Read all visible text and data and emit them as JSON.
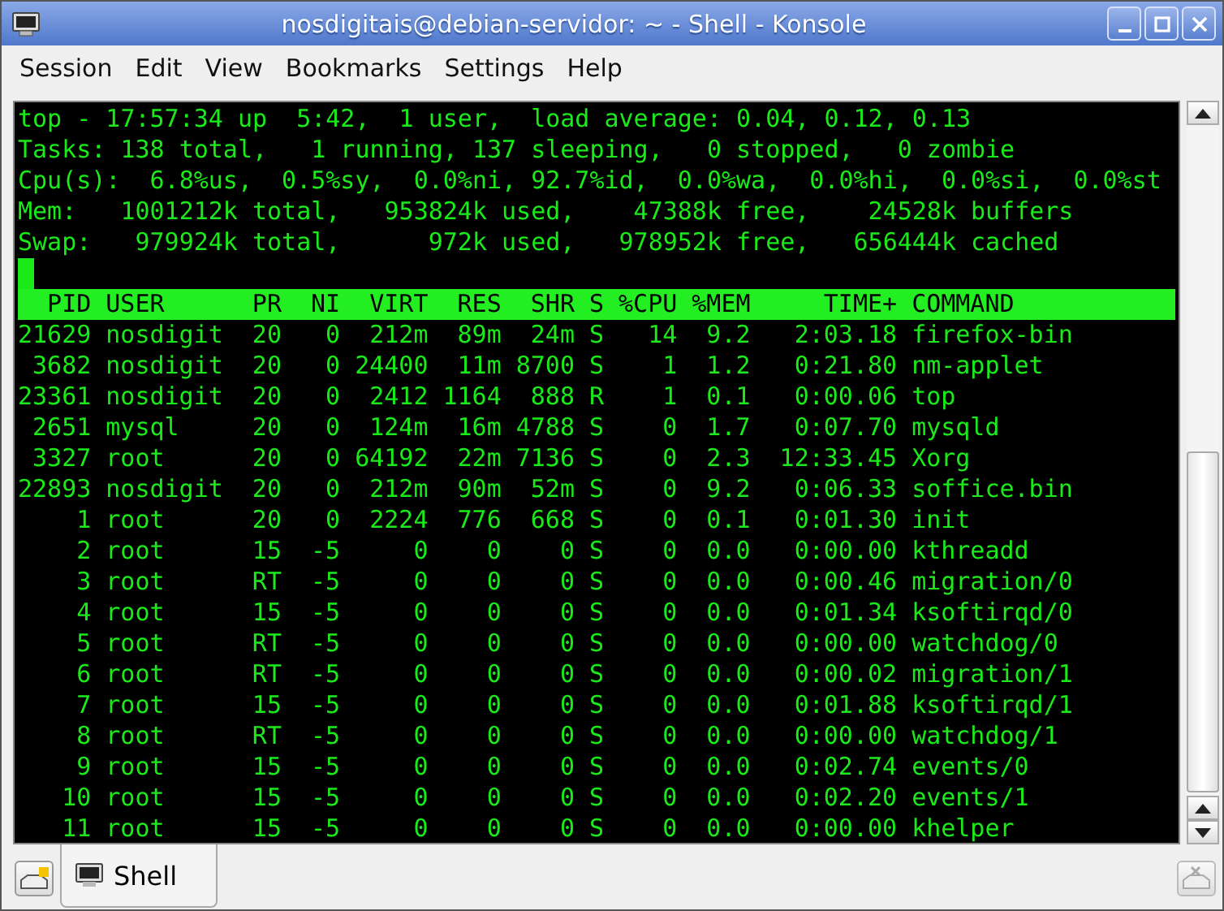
{
  "window": {
    "title": "nosdigitais@debian-servidor: ~ - Shell - Konsole"
  },
  "menu": [
    "Session",
    "Edit",
    "View",
    "Bookmarks",
    "Settings",
    "Help"
  ],
  "terminal": {
    "summary_lines": [
      "top - 17:57:34 up  5:42,  1 user,  load average: 0.04, 0.12, 0.13",
      "Tasks: 138 total,   1 running, 137 sleeping,   0 stopped,   0 zombie",
      "Cpu(s):  6.8%us,  0.5%sy,  0.0%ni, 92.7%id,  0.0%wa,  0.0%hi,  0.0%si,  0.0%st",
      "Mem:   1001212k total,   953824k used,    47388k free,    24528k buffers",
      "Swap:   979924k total,      972k used,   978952k free,   656444k cached"
    ],
    "columns": [
      "PID",
      "USER",
      "PR",
      "NI",
      "VIRT",
      "RES",
      "SHR",
      "S",
      "%CPU",
      "%MEM",
      "TIME+",
      "COMMAND"
    ],
    "rows": [
      [
        "21629",
        "nosdigit",
        "20",
        "0",
        "212m",
        "89m",
        "24m",
        "S",
        "14",
        "9.2",
        "2:03.18",
        "firefox-bin"
      ],
      [
        "3682",
        "nosdigit",
        "20",
        "0",
        "24400",
        "11m",
        "8700",
        "S",
        "1",
        "1.2",
        "0:21.80",
        "nm-applet"
      ],
      [
        "23361",
        "nosdigit",
        "20",
        "0",
        "2412",
        "1164",
        "888",
        "R",
        "1",
        "0.1",
        "0:00.06",
        "top"
      ],
      [
        "2651",
        "mysql",
        "20",
        "0",
        "124m",
        "16m",
        "4788",
        "S",
        "0",
        "1.7",
        "0:07.70",
        "mysqld"
      ],
      [
        "3327",
        "root",
        "20",
        "0",
        "64192",
        "22m",
        "7136",
        "S",
        "0",
        "2.3",
        "12:33.45",
        "Xorg"
      ],
      [
        "22893",
        "nosdigit",
        "20",
        "0",
        "212m",
        "90m",
        "52m",
        "S",
        "0",
        "9.2",
        "0:06.33",
        "soffice.bin"
      ],
      [
        "1",
        "root",
        "20",
        "0",
        "2224",
        "776",
        "668",
        "S",
        "0",
        "0.1",
        "0:01.30",
        "init"
      ],
      [
        "2",
        "root",
        "15",
        "-5",
        "0",
        "0",
        "0",
        "S",
        "0",
        "0.0",
        "0:00.00",
        "kthreadd"
      ],
      [
        "3",
        "root",
        "RT",
        "-5",
        "0",
        "0",
        "0",
        "S",
        "0",
        "0.0",
        "0:00.46",
        "migration/0"
      ],
      [
        "4",
        "root",
        "15",
        "-5",
        "0",
        "0",
        "0",
        "S",
        "0",
        "0.0",
        "0:01.34",
        "ksoftirqd/0"
      ],
      [
        "5",
        "root",
        "RT",
        "-5",
        "0",
        "0",
        "0",
        "S",
        "0",
        "0.0",
        "0:00.00",
        "watchdog/0"
      ],
      [
        "6",
        "root",
        "RT",
        "-5",
        "0",
        "0",
        "0",
        "S",
        "0",
        "0.0",
        "0:00.02",
        "migration/1"
      ],
      [
        "7",
        "root",
        "15",
        "-5",
        "0",
        "0",
        "0",
        "S",
        "0",
        "0.0",
        "0:01.88",
        "ksoftirqd/1"
      ],
      [
        "8",
        "root",
        "RT",
        "-5",
        "0",
        "0",
        "0",
        "S",
        "0",
        "0.0",
        "0:00.00",
        "watchdog/1"
      ],
      [
        "9",
        "root",
        "15",
        "-5",
        "0",
        "0",
        "0",
        "S",
        "0",
        "0.0",
        "0:02.74",
        "events/0"
      ],
      [
        "10",
        "root",
        "15",
        "-5",
        "0",
        "0",
        "0",
        "S",
        "0",
        "0.0",
        "0:02.20",
        "events/1"
      ],
      [
        "11",
        "root",
        "15",
        "-5",
        "0",
        "0",
        "0",
        "S",
        "0",
        "0.0",
        "0:00.00",
        "khelper"
      ]
    ]
  },
  "tabs": [
    {
      "label": "Shell",
      "selected": true
    }
  ]
}
